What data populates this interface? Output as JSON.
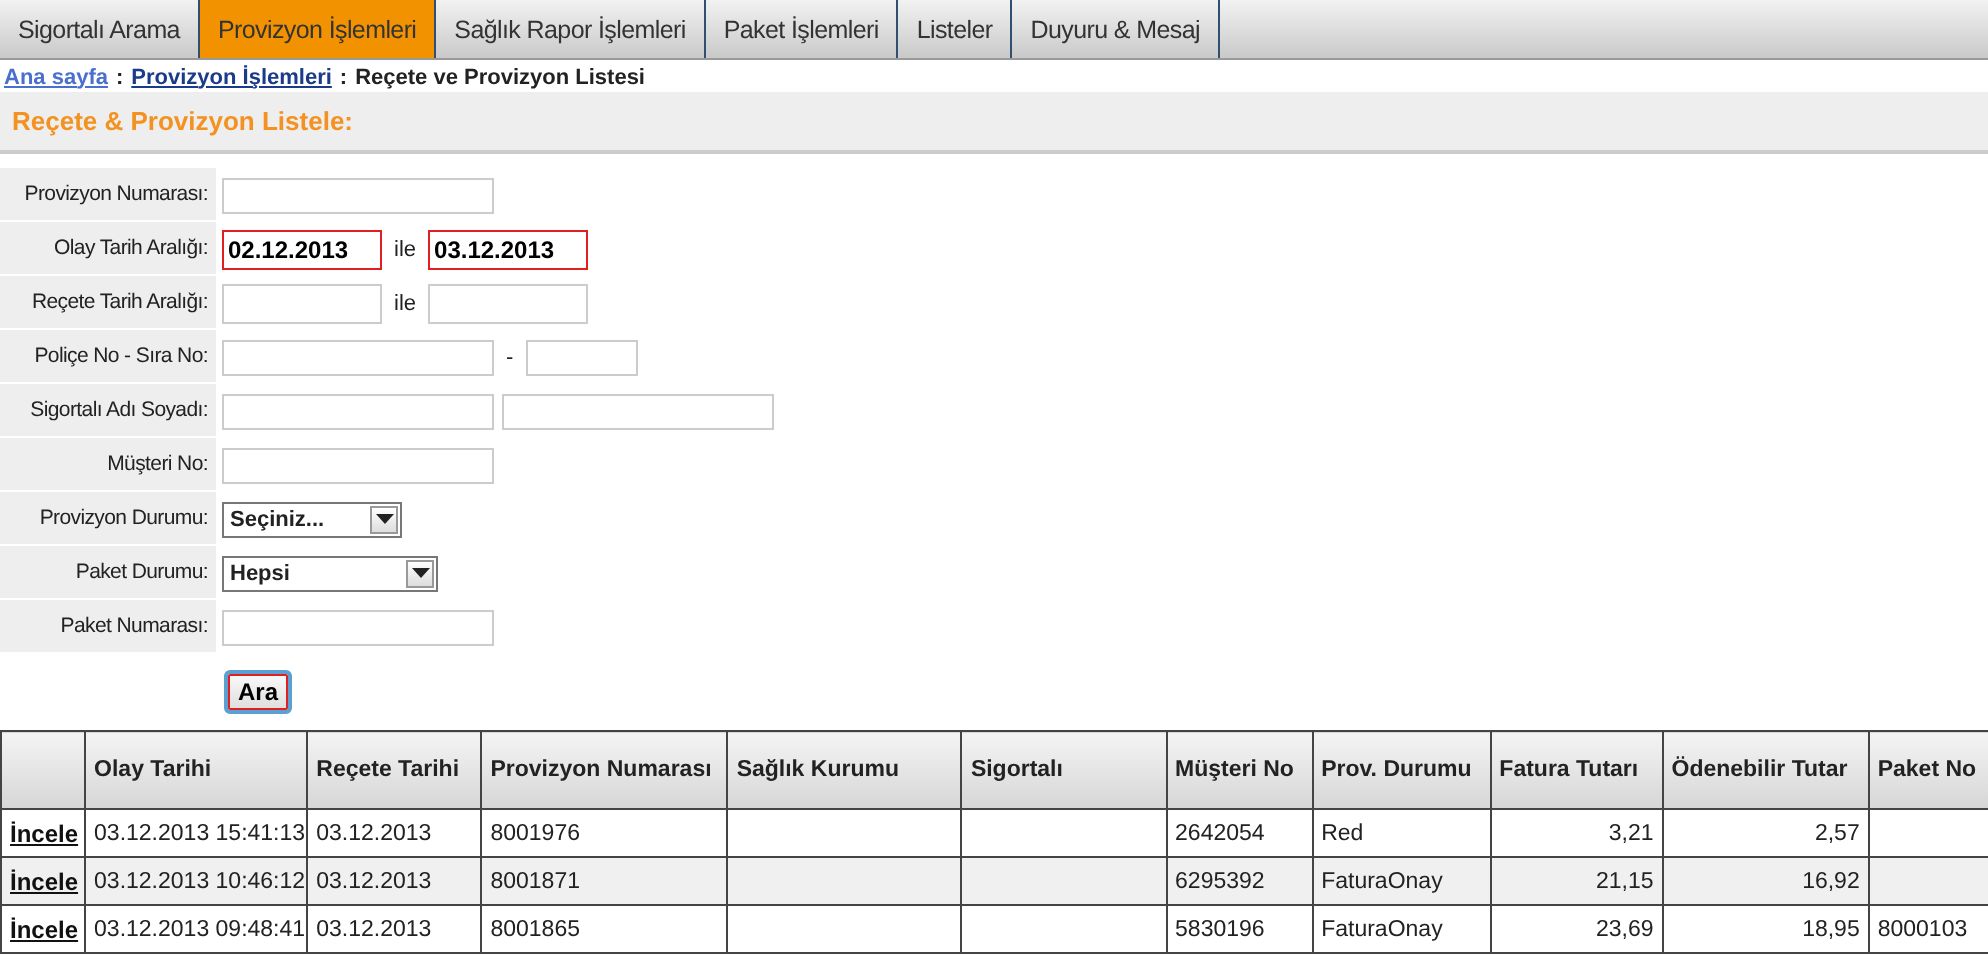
{
  "tabs": [
    {
      "label": "Sigortalı Arama",
      "selected": false
    },
    {
      "label": "Provizyon İşlemleri",
      "selected": true
    },
    {
      "label": "Sağlık Rapor İşlemleri",
      "selected": false
    },
    {
      "label": "Paket İşlemleri",
      "selected": false
    },
    {
      "label": "Listeler",
      "selected": false
    },
    {
      "label": "Duyuru & Mesaj",
      "selected": false
    }
  ],
  "breadcrumb": [
    {
      "label": "Ana sayfa",
      "kind": "link",
      "visited": false
    },
    {
      "label": ":",
      "kind": "separator"
    },
    {
      "label": "Provizyon İşlemleri",
      "kind": "link",
      "visited": true
    },
    {
      "label": ":",
      "kind": "separator"
    },
    {
      "label": "Reçete ve Provizyon Listesi",
      "kind": "current"
    }
  ],
  "section_title": "Reçete & Provizyon Listele:",
  "form": {
    "rows": [
      {
        "label": "Provizyon Numarası:",
        "fields": [
          {
            "kind": "text"
          }
        ]
      },
      {
        "label": "Olay Tarih Aralığı:",
        "fields": [
          {
            "kind": "date",
            "value": "02.12.2013",
            "highlighted": true
          },
          {
            "kind": "separator",
            "text": "ile"
          },
          {
            "kind": "date",
            "value": "03.12.2013",
            "highlighted": true
          }
        ]
      },
      {
        "label": "Reçete Tarih Aralığı:",
        "fields": [
          {
            "kind": "date",
            "highlighted": false
          },
          {
            "kind": "separator",
            "text": "ile"
          },
          {
            "kind": "date",
            "highlighted": false
          }
        ]
      },
      {
        "label": "Poliçe No - Sıra No:",
        "fields": [
          {
            "kind": "text"
          },
          {
            "kind": "separator",
            "text": "-"
          },
          {
            "kind": "short"
          }
        ]
      },
      {
        "label": "Sigortalı Adı Soyadı:",
        "fields": [
          {
            "kind": "text"
          },
          {
            "kind": "text"
          }
        ]
      },
      {
        "label": "Müşteri No:",
        "fields": [
          {
            "kind": "text"
          }
        ]
      },
      {
        "label": "Provizyon Durumu:",
        "fields": [
          {
            "kind": "select",
            "value": "Seçiniz..."
          }
        ]
      },
      {
        "label": "Paket Durumu:",
        "fields": [
          {
            "kind": "select-wide",
            "value": "Hepsi"
          }
        ]
      },
      {
        "label": "Paket Numarası:",
        "fields": [
          {
            "kind": "text"
          }
        ]
      }
    ],
    "search_button": {
      "label": "Ara",
      "highlighted": true
    }
  },
  "table": {
    "columns": [
      "",
      "Olay Tarihi",
      "Reçete Tarihi",
      "Provizyon Numarası",
      "Sağlık Kurumu",
      "Sigortalı",
      "Müşteri No",
      "Prov. Durumu",
      "Fatura Tutarı",
      "Ödenebilir Tutar",
      "Paket No"
    ],
    "rows": [
      {
        "cells": [
          "İncele",
          "03.12.2013 15:41:13",
          "03.12.2013",
          "8001976",
          "",
          "",
          "2642054",
          "Red",
          "3,21",
          "2,57",
          ""
        ]
      },
      {
        "cells": [
          "İncele",
          "03.12.2013 10:46:12",
          "03.12.2013",
          "8001871",
          "",
          "",
          "6295392",
          "FaturaOnay",
          "21,15",
          "16,92",
          ""
        ]
      },
      {
        "cells": [
          "İncele",
          "03.12.2013 09:48:41",
          "03.12.2013",
          "8001865",
          "",
          "",
          "5830196",
          "FaturaOnay",
          "23,69",
          "18,95",
          "8000103"
        ]
      }
    ]
  }
}
